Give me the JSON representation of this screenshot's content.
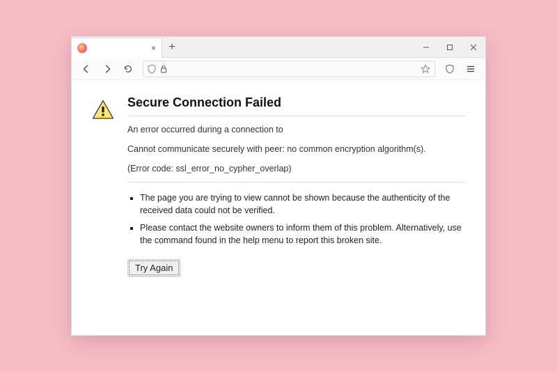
{
  "tab": {
    "title": "",
    "close": "×"
  },
  "newtab": "+",
  "wincontrols": {
    "min": "—",
    "max": "▢",
    "close": "×"
  },
  "url": {
    "value": ""
  },
  "error": {
    "title": "Secure Connection Failed",
    "line1": "An error occurred during a connection to",
    "line2": "Cannot communicate securely with peer: no common encryption algorithm(s).",
    "code": "(Error code: ssl_error_no_cypher_overlap)",
    "bullets": [
      "The page you are trying to view cannot be shown because the authenticity of the received data could not be verified.",
      "Please contact the website owners to inform them of this problem. Alternatively, use the command found in the help menu to report this broken site."
    ],
    "try_again": "Try Again"
  }
}
